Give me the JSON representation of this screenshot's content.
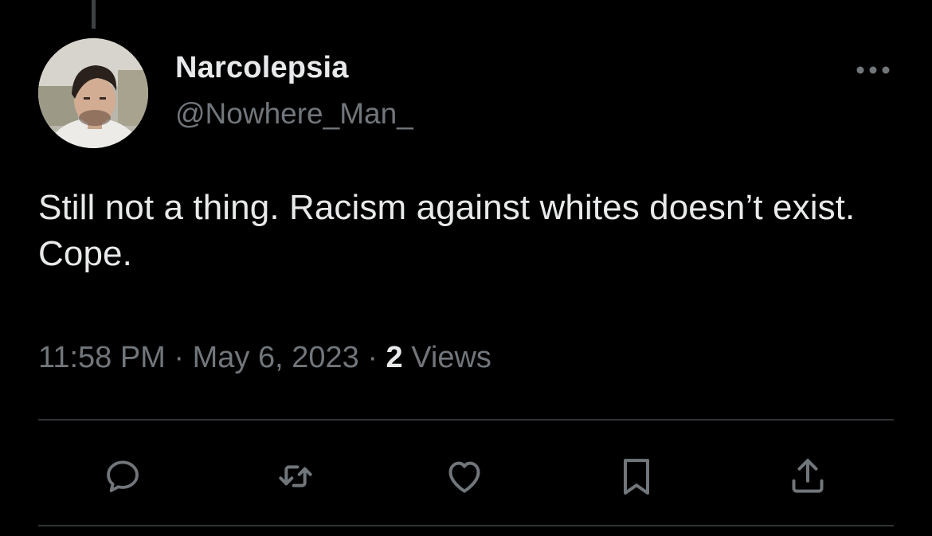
{
  "tweet": {
    "author": {
      "display_name": "Narcolepsia",
      "handle": "@Nowhere_Man_"
    },
    "text": "Still not a thing. Racism against whites doesn’t exist. Cope.",
    "time": "11:58 PM",
    "separator": "·",
    "date": "May 6, 2023",
    "views_count": "2",
    "views_label": "Views"
  },
  "actions": [
    {
      "name": "reply",
      "icon": "reply-icon"
    },
    {
      "name": "retweet",
      "icon": "retweet-icon"
    },
    {
      "name": "like",
      "icon": "heart-icon"
    },
    {
      "name": "bookmark",
      "icon": "bookmark-icon"
    },
    {
      "name": "share",
      "icon": "share-icon"
    }
  ],
  "colors": {
    "background": "#000000",
    "text_primary": "#e7e9ea",
    "text_secondary": "#71767b",
    "divider": "#2f3336"
  }
}
